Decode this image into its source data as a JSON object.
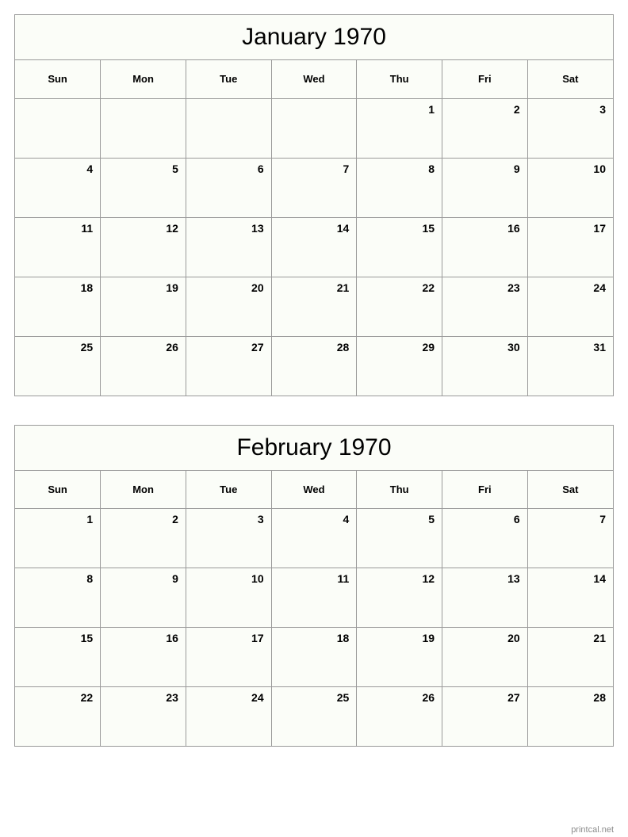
{
  "footer": {
    "attribution": "printcal.net"
  },
  "weekday_headers": [
    "Sun",
    "Mon",
    "Tue",
    "Wed",
    "Thu",
    "Fri",
    "Sat"
  ],
  "months": [
    {
      "title": "January 1970",
      "weeks": [
        [
          "",
          "",
          "",
          "",
          "1",
          "2",
          "3"
        ],
        [
          "4",
          "5",
          "6",
          "7",
          "8",
          "9",
          "10"
        ],
        [
          "11",
          "12",
          "13",
          "14",
          "15",
          "16",
          "17"
        ],
        [
          "18",
          "19",
          "20",
          "21",
          "22",
          "23",
          "24"
        ],
        [
          "25",
          "26",
          "27",
          "28",
          "29",
          "30",
          "31"
        ]
      ]
    },
    {
      "title": "February 1970",
      "weeks": [
        [
          "1",
          "2",
          "3",
          "4",
          "5",
          "6",
          "7"
        ],
        [
          "8",
          "9",
          "10",
          "11",
          "12",
          "13",
          "14"
        ],
        [
          "15",
          "16",
          "17",
          "18",
          "19",
          "20",
          "21"
        ],
        [
          "22",
          "23",
          "24",
          "25",
          "26",
          "27",
          "28"
        ]
      ]
    }
  ]
}
